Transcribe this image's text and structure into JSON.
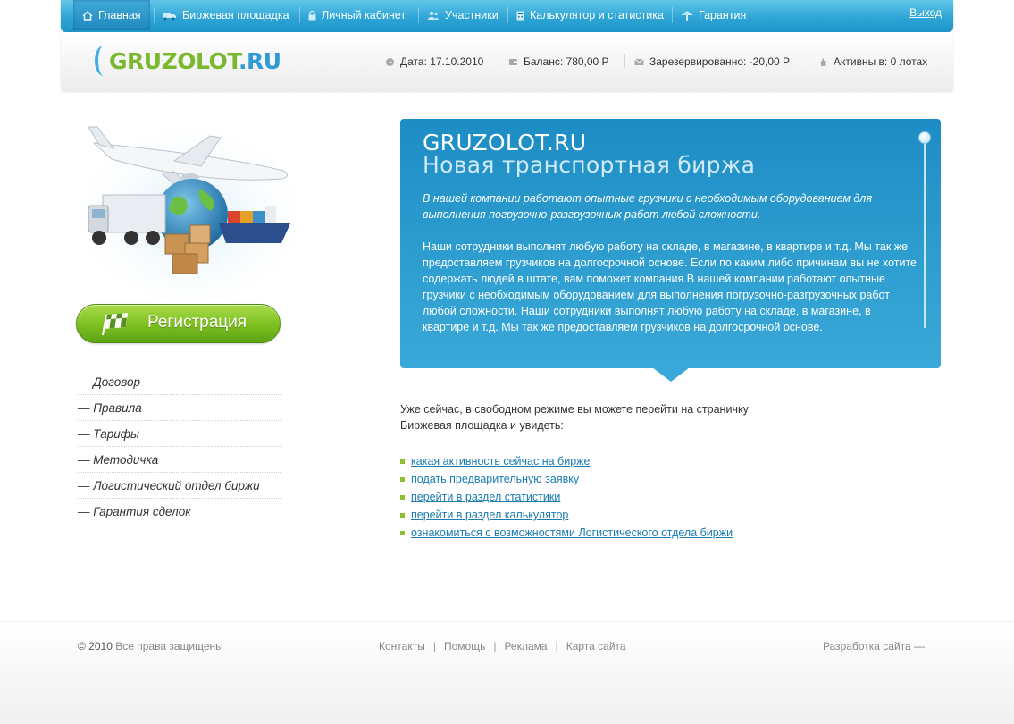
{
  "nav": {
    "items": [
      {
        "label": "Главная",
        "icon": "home-icon",
        "active": true
      },
      {
        "label": "Биржевая площадка",
        "icon": "truck-icon"
      },
      {
        "label": "Личный кабинет",
        "icon": "lock-icon"
      },
      {
        "label": "Участники",
        "icon": "users-icon"
      },
      {
        "label": "Калькулятор и статистика",
        "icon": "calculator-icon"
      },
      {
        "label": "Гарантия",
        "icon": "guarantee-icon"
      }
    ],
    "logout": "Выход"
  },
  "header": {
    "logo_main": "GRUZOLOT",
    "logo_tld": ".RU",
    "stats": {
      "date": "Дата: 17.10.2010",
      "balance": "Баланс: 780,00 Р",
      "reserved": "Зарезервированно: -20,00 Р",
      "active": "Активны в: 0 лотах"
    }
  },
  "sidebar": {
    "register_label": "Регистрация",
    "menu": [
      "— Договор",
      "— Правила",
      "— Тарифы",
      "— Методичка",
      "— Логистический отдел биржи",
      "— Гарантия сделок"
    ]
  },
  "infobox": {
    "title1": "GRUZOLOT.RU",
    "title2": "Новая транспортная биржа",
    "lead": "В нашей компании работают опытные грузчики с необходимым оборудованием для выполнения погрузочно-разгрузочных работ любой сложности.",
    "body": "Наши сотрудники выполнят любую работу на складе, в магазине, в квартире и т.д. Мы так же предоставляем грузчиков на долгосрочной основе. Если по каким либо причинам вы не хотите содержать людей в штате, вам поможет компания.В нашей компании работают опытные грузчики с необходимым оборудованием для выполнения погрузочно-разгрузочных работ любой сложности. Наши сотрудники выполнят любую работу на складе, в магазине, в квартире и т.д. Мы так же предоставляем грузчиков на долгосрочной основе."
  },
  "main": {
    "intro_line1": "Уже сейчас, в свободном режиме вы можете перейти на страничку",
    "intro_line2": "Биржевая площадка и увидеть:",
    "links": [
      "какая активность сейчас на бирже",
      "подать предварительную заявку",
      "перейти в раздел статистики",
      "перейти в раздел калькулятор",
      "ознакомиться с возможностями Логистического отдела биржи"
    ]
  },
  "footer": {
    "copy_year": "© 2010",
    "copy_text": "Все права защищены",
    "links": [
      "Контакты",
      "Помощь",
      "Реклама",
      "Карта сайта"
    ],
    "developer": "Разработка сайта —"
  },
  "colors": {
    "nav_blue": "#2ea5d6",
    "accent_green": "#7cbf20",
    "link_blue": "#1a7cb2",
    "infobox_blue": "#2c9ccf"
  }
}
